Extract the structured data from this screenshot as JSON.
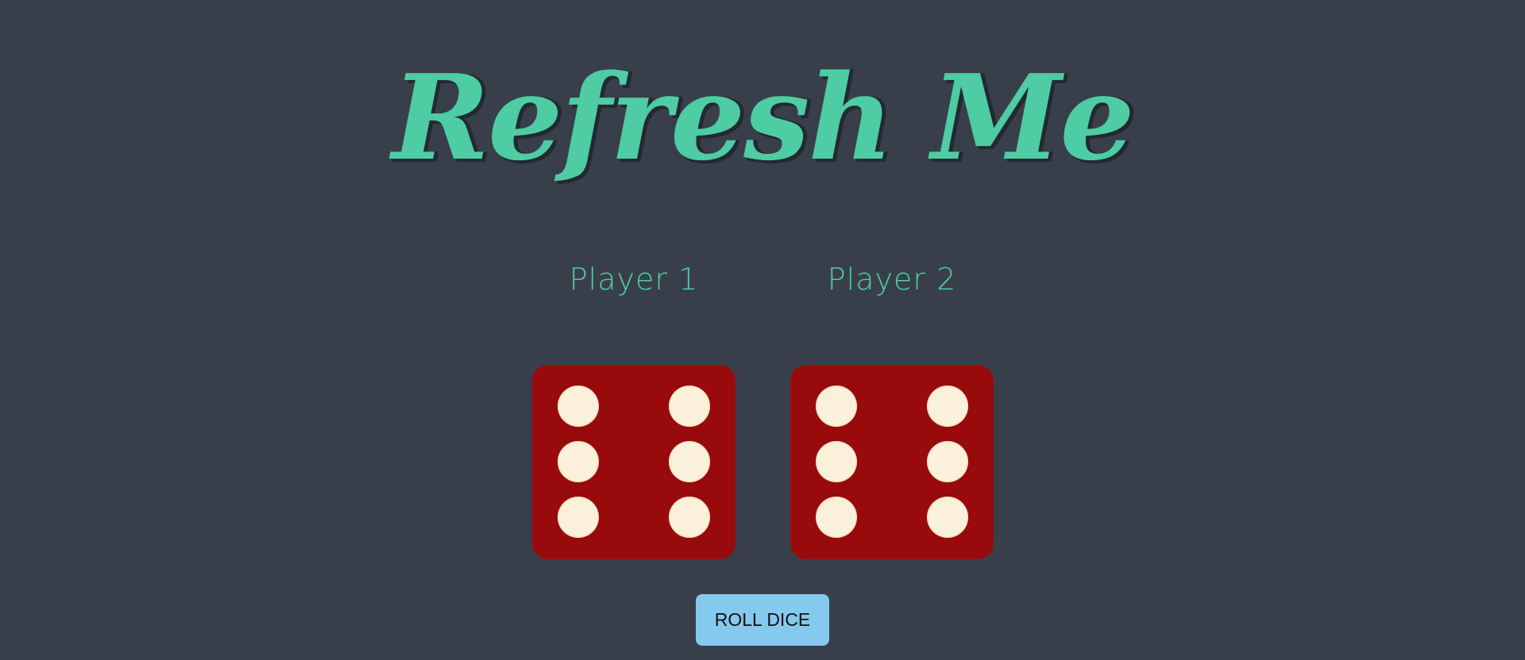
{
  "title": "Refresh Me",
  "players": [
    {
      "label": "Player 1",
      "die_value": 6
    },
    {
      "label": "Player 2",
      "die_value": 6
    }
  ],
  "roll_button": {
    "label": "ROLL DICE"
  },
  "colors": {
    "background": "#393f4a",
    "accent": "#4ecca3",
    "die": "#990a0d",
    "pip": "#fbf0d9",
    "button": "#85c9ef"
  }
}
